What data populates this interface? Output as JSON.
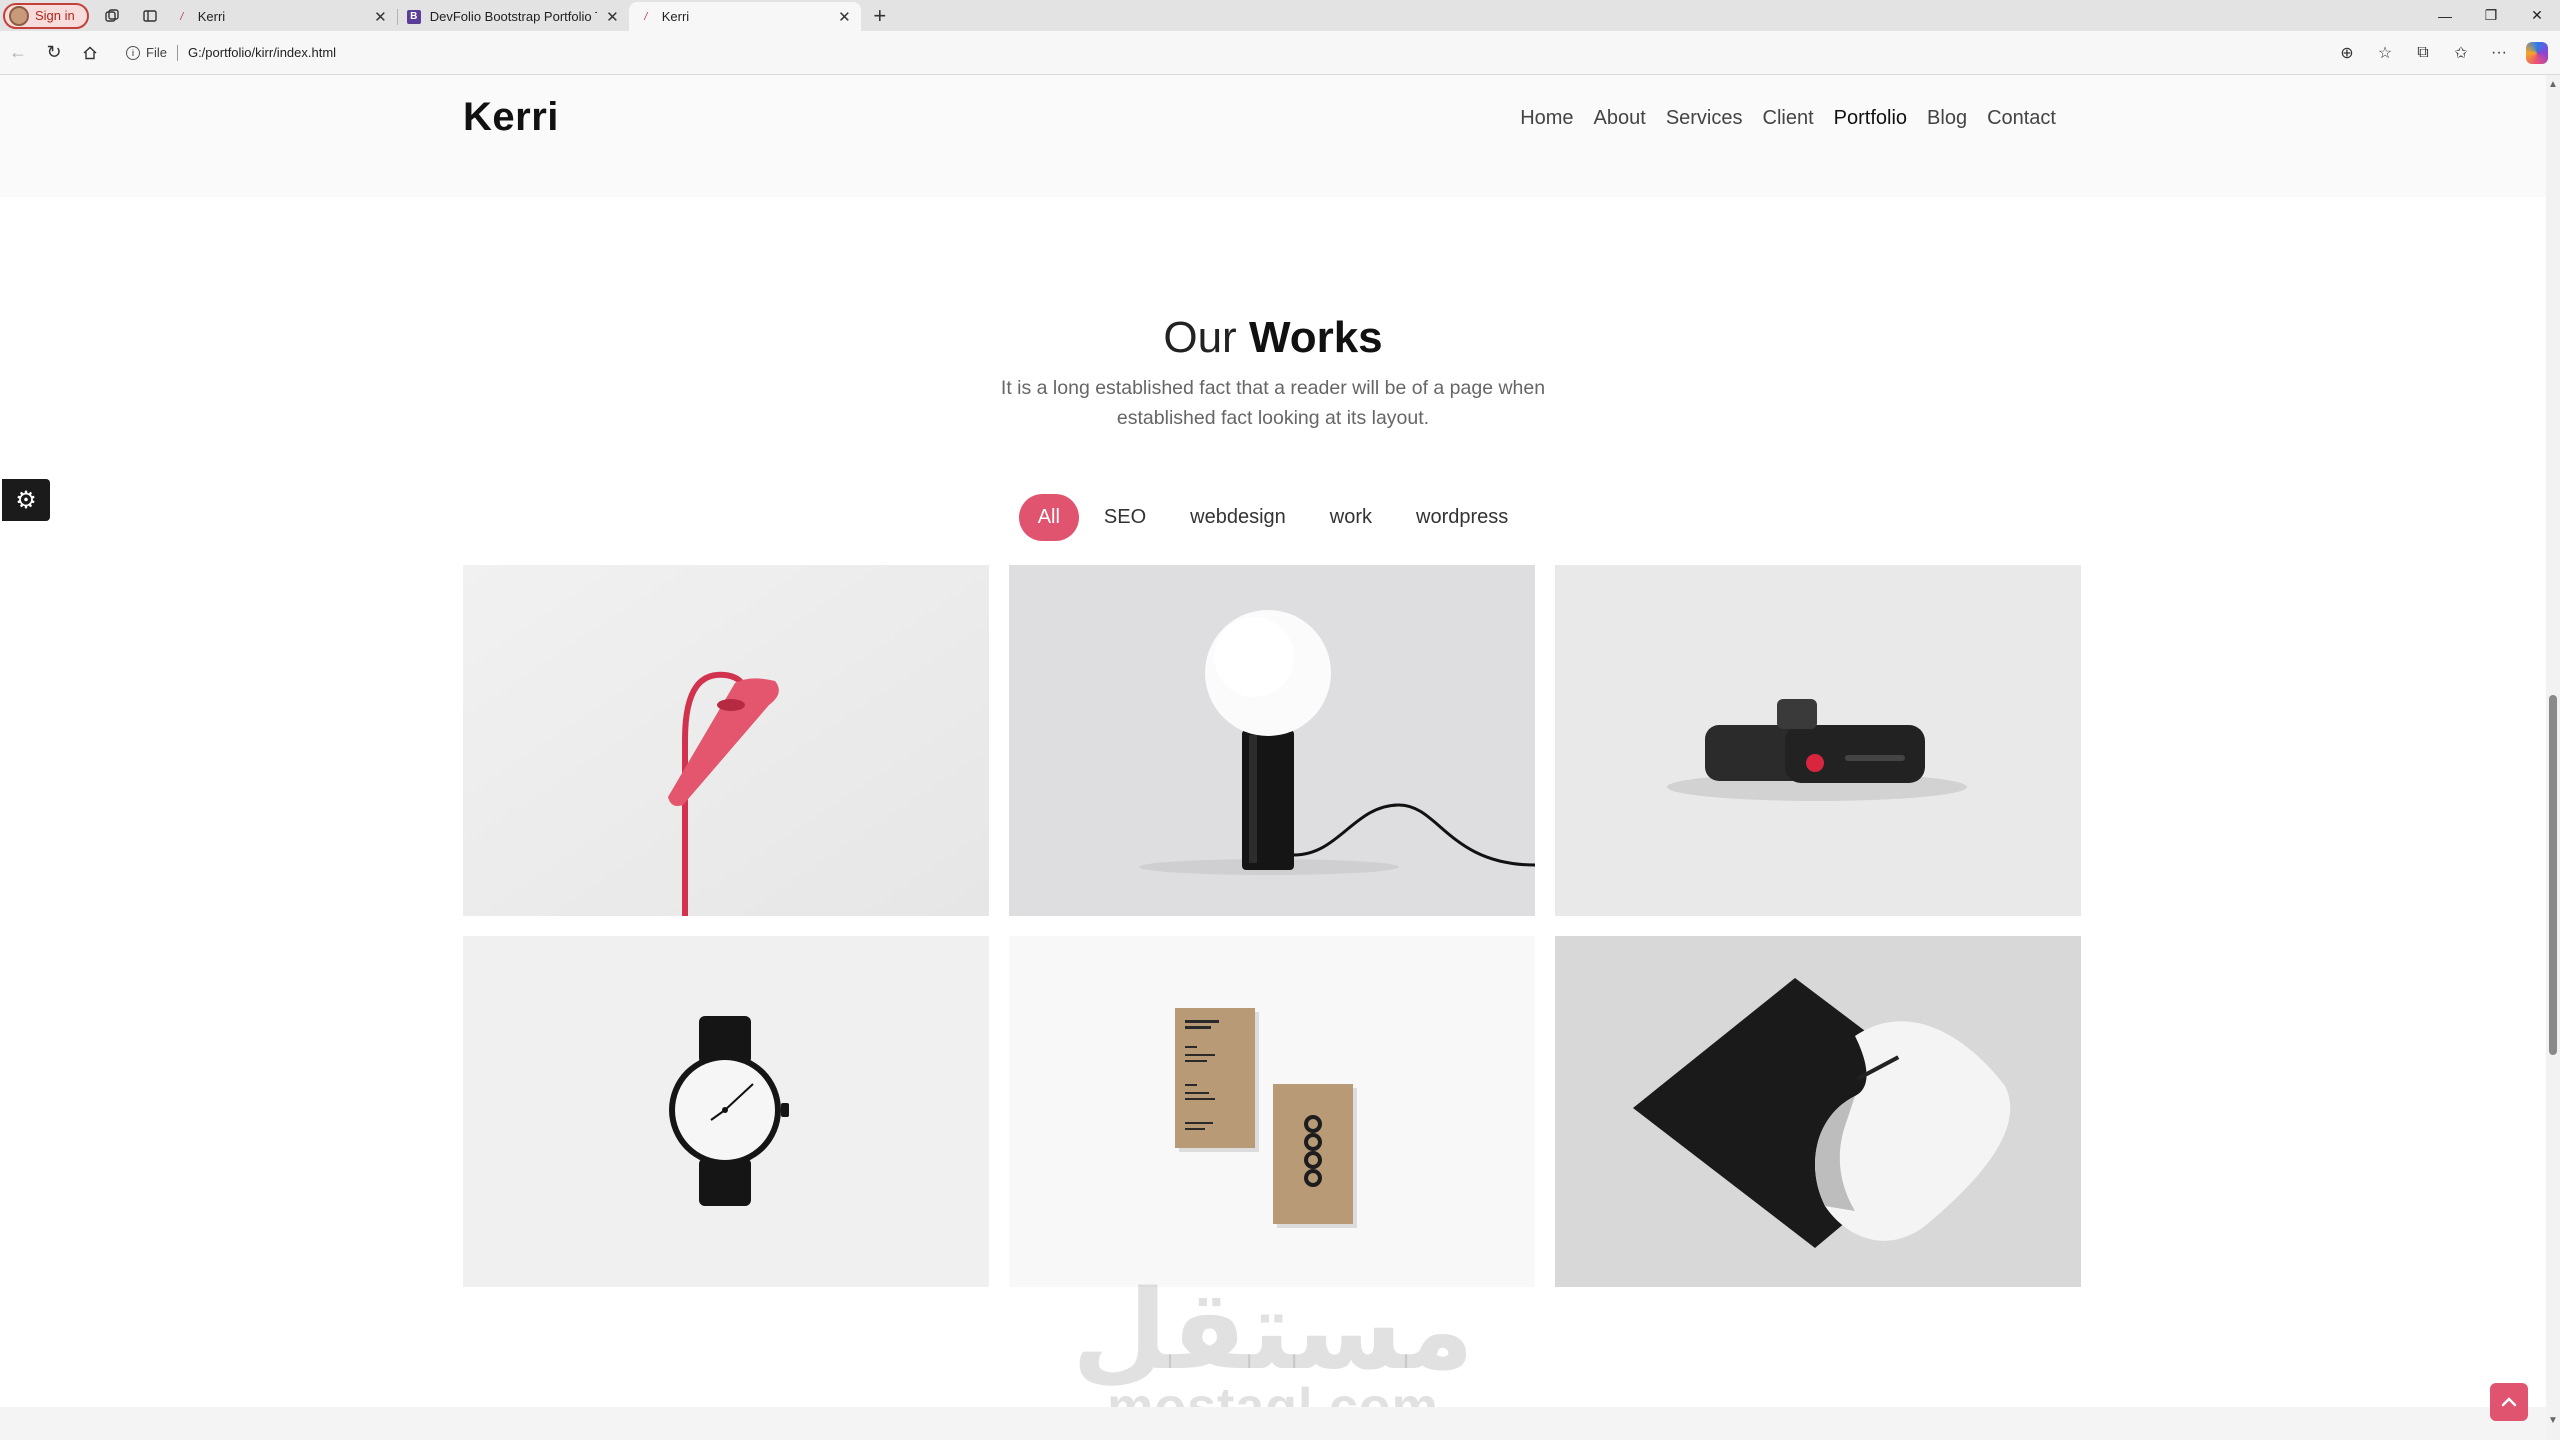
{
  "browser": {
    "signin_label": "Sign in",
    "tabs": [
      {
        "title": "Kerri",
        "favicon": "kerri-favicon"
      },
      {
        "title": "DevFolio Bootstrap Portfolio Template",
        "favicon": "bootstrap-favicon",
        "favicon_text": "B"
      },
      {
        "title": "Kerri",
        "favicon": "kerri-favicon",
        "active": true
      }
    ],
    "address": {
      "scheme_label": "File",
      "url": "G:/portfolio/kirr/index.html"
    }
  },
  "site": {
    "brand": "Kerri",
    "nav": [
      "Home",
      "About",
      "Services",
      "Client",
      "Portfolio",
      "Blog",
      "Contact"
    ],
    "active_nav": "Portfolio"
  },
  "works": {
    "title_light": "Our",
    "title_bold": "Works",
    "subtitle": "It is a long established fact that a reader will be of a page when established fact looking at its layout.",
    "filters": [
      "All",
      "SEO",
      "webdesign",
      "work",
      "wordpress"
    ],
    "active_filter": "All",
    "items": [
      {
        "name": "red-desk-lamp"
      },
      {
        "name": "globe-lamp"
      },
      {
        "name": "black-camera"
      },
      {
        "name": "wrist-watch"
      },
      {
        "name": "business-cards"
      },
      {
        "name": "letter-envelope"
      }
    ]
  },
  "watermark": {
    "arabic": "مستقل",
    "latin": "mostaql.com"
  },
  "colors": {
    "accent": "#e05470",
    "header_bg": "#fafafa",
    "text": "#212529"
  }
}
